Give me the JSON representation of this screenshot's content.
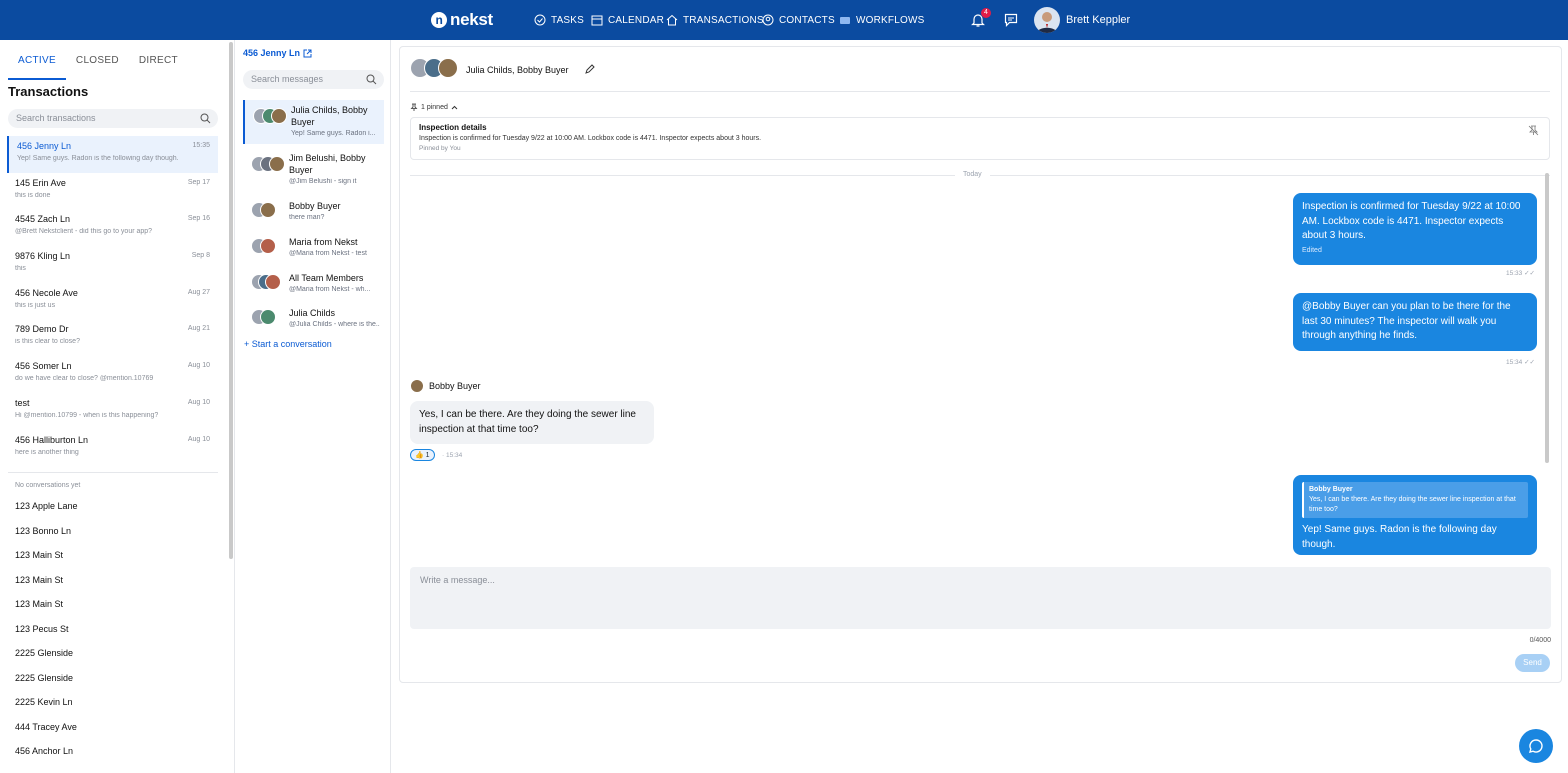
{
  "topbar": {
    "logo": "nekst",
    "nav": [
      {
        "label": "TASKS",
        "icon": "check-circle-icon"
      },
      {
        "label": "CALENDAR",
        "icon": "calendar-icon"
      },
      {
        "label": "TRANSACTIONS",
        "icon": "home-icon"
      },
      {
        "label": "CONTACTS",
        "icon": "contact-icon"
      },
      {
        "label": "WORKFLOWS",
        "icon": "folder-icon"
      }
    ],
    "notification_count": "4",
    "user_name": "Brett Keppler"
  },
  "left": {
    "tabs": [
      "ACTIVE",
      "CLOSED",
      "DIRECT"
    ],
    "title": "Transactions",
    "search_placeholder": "Search transactions",
    "transactions": [
      {
        "name": "456 Jenny Ln",
        "date": "15:35",
        "preview": "Yep! Same guys. Radon is the following day though."
      },
      {
        "name": "145 Erin Ave",
        "date": "Sep 17",
        "preview": "this is done"
      },
      {
        "name": "4545 Zach Ln",
        "date": "Sep 16",
        "preview": "@Brett Nekstclient - did this go to your app?"
      },
      {
        "name": "9876 Kling Ln",
        "date": "Sep 8",
        "preview": "this"
      },
      {
        "name": "456 Necole Ave",
        "date": "Aug 27",
        "preview": "this is just us"
      },
      {
        "name": "789 Demo Dr",
        "date": "Aug 21",
        "preview": "is this clear to close?"
      },
      {
        "name": "456 Somer Ln",
        "date": "Aug 10",
        "preview": "do we have clear to close? @mention.10769"
      },
      {
        "name": "test",
        "date": "Aug 10",
        "preview": "Hi @mention.10799 - when is this happening?"
      },
      {
        "name": "456 Halliburton Ln",
        "date": "Aug 10",
        "preview": "here is another thing"
      }
    ],
    "no_conv_label": "No conversations yet",
    "empty": [
      "123 Apple Lane",
      "123 Bonno Ln",
      "123 Main St",
      "123 Main St",
      "123 Main St",
      "123 Pecus St",
      "2225 Glenside",
      "2225 Glenside",
      "2225 Kevin Ln",
      "444 Tracey Ave",
      "456 Anchor Ln"
    ]
  },
  "mid": {
    "header": "456 Jenny Ln",
    "search_placeholder": "Search messages",
    "conversations": [
      {
        "name": "Julia Childs, Bobby Buyer",
        "preview": "Yep! Same guys. Radon i..."
      },
      {
        "name": "Jim Belushi, Bobby Buyer",
        "preview": "@Jim Belushi - sign it"
      },
      {
        "name": "Bobby Buyer",
        "preview": "there man?"
      },
      {
        "name": "Maria from Nekst",
        "preview": "@Maria from Nekst - test"
      },
      {
        "name": "All Team Members",
        "preview": "@Maria from Nekst - wh..."
      },
      {
        "name": "Julia Childs",
        "preview": "@Julia Childs - where is the..."
      }
    ],
    "start_label": "Start a conversation"
  },
  "main": {
    "title": "Julia Childs, Bobby Buyer",
    "pinned_label": "1 pinned",
    "pin": {
      "title": "Inspection details",
      "body": "Inspection is confirmed for Tuesday 9/22 at 10:00 AM. Lockbox code is 4471. Inspector expects about 3 hours.",
      "footer": "Pinned by You"
    },
    "today_label": "Today",
    "messages": [
      {
        "text": "Inspection is confirmed for Tuesday 9/22 at 10:00 AM. Lockbox code is 4471. Inspector expects about 3 hours.",
        "edited": "Edited",
        "time": "15:33"
      },
      {
        "text": "@Bobby Buyer  can you plan to be there for the last 30 minutes? The inspector will walk you through anything he finds.",
        "time": "15:34"
      },
      {
        "sender": "Bobby Buyer",
        "text": "Yes, I can be there. Are they doing the sewer line inspection at that time too?",
        "reaction": "👍 1",
        "time": "15:34"
      },
      {
        "quote_sender": "Bobby Buyer",
        "quote_text": "Yes, I can be there. Are they doing the sewer line inspection at that time too?",
        "text": "Yep! Same guys. Radon is the following day though."
      }
    ],
    "compose_placeholder": "Write a message...",
    "counter": "0/4000",
    "send_label": "Send"
  },
  "colors": {
    "brand": "#0b4ba0",
    "accent": "#1a86e0"
  }
}
